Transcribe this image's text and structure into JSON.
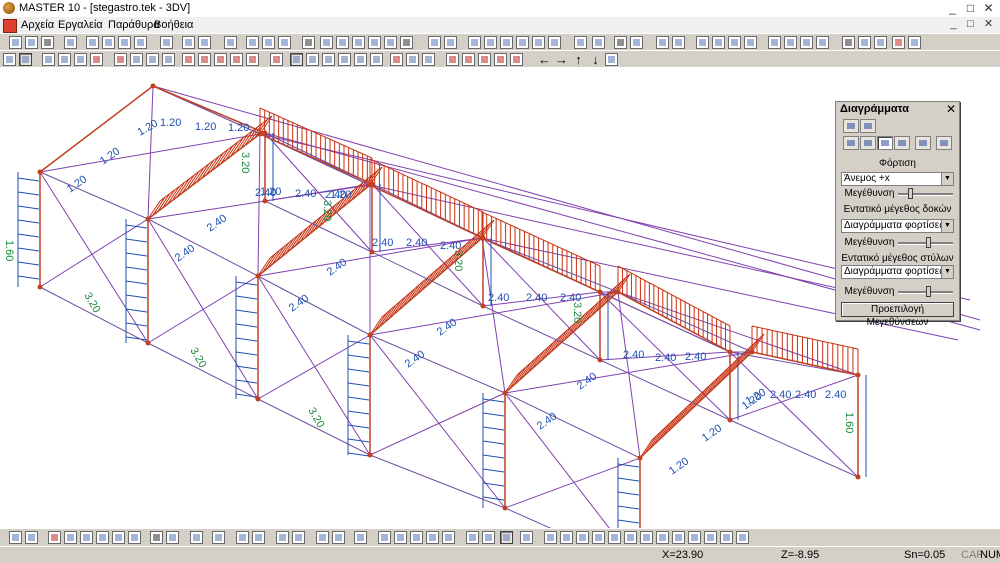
{
  "window": {
    "title": "MASTER 10 - [stegastro.tek - 3DV]",
    "minimize": "_",
    "maximize": "□",
    "close": "✕"
  },
  "menu": {
    "items": [
      "Αρχεία",
      "Εργαλεία",
      "Παράθυρα",
      "Βοήθεια"
    ]
  },
  "colors": {
    "frame": "#c04020",
    "load": "#1f4fb0",
    "bracing": "#8040b0",
    "hatch": "#c83010",
    "dim": "#1a8a3a"
  },
  "canvas": {
    "labels_blue": [
      "1.20",
      "1.20",
      "1.20",
      "1.20",
      "1.20",
      "1.20",
      "2.40",
      "2.40",
      "2.40",
      "2.40",
      "2.40",
      "2.40",
      "2.40",
      "2.40",
      "2.40",
      "2.40",
      "2.40",
      "2.40",
      "2.40",
      "2.40",
      "2.40",
      "2.40",
      "2.40",
      "2.40",
      "2.40",
      "2.40",
      "2.40",
      "2.40",
      "2.40",
      "1.20",
      "1.20",
      "1.20",
      "1.20",
      "1.20",
      "1.20"
    ],
    "labels_green": [
      "1.60",
      "3.20",
      "3.20",
      "3.20",
      "3.20",
      "3.20",
      "3.20",
      "3.20",
      "1.60"
    ]
  },
  "panel": {
    "title": "Διαγράμματα",
    "close": "✕",
    "loads_label": "Φόρτιση",
    "loads_value": "Άνεμος +x",
    "scale_label_1": "Μεγέθυνση",
    "scale_1": 0.2,
    "beams_label": "Εντατικό μέγεθος δοκών",
    "beams_value": "Διαγράμματα φορτίσεων",
    "scale_label_2": "Μεγέθυνση",
    "scale_2": 0.55,
    "columns_label": "Εντατικό μέγεθος στύλων",
    "columns_value": "Διαγράμματα φορτίσεων",
    "scale_label_3": "Μεγέθυνση",
    "scale_3": 0.55,
    "preset_button": "Προεπιλογή Μεγεθύνσεων"
  },
  "status": {
    "x": "X=23.90",
    "z": "Z=-8.95",
    "sn": "Sn=0.05",
    "caf": "CAF",
    "num": "NUM"
  }
}
